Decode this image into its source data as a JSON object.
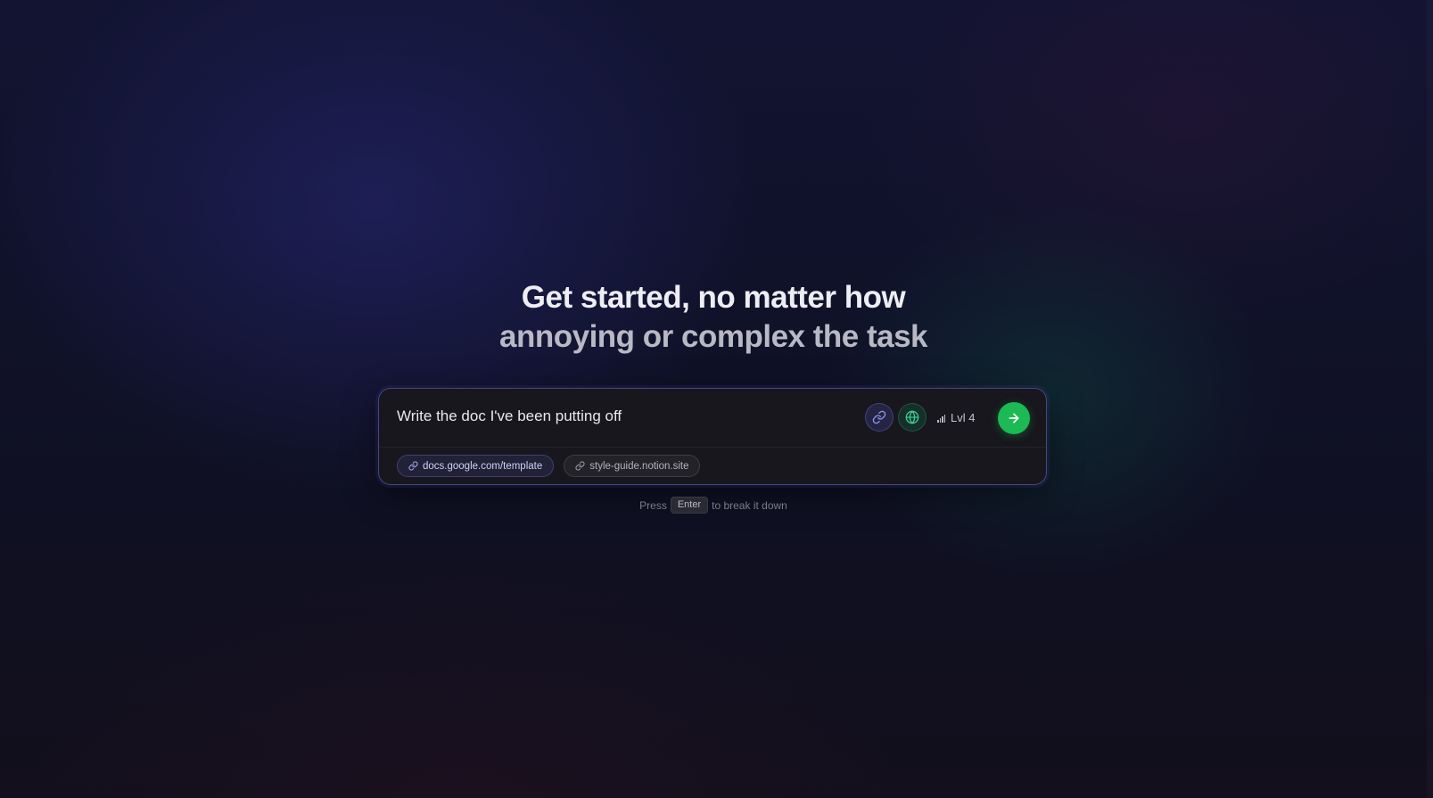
{
  "hero": {
    "line1": "Get started, no matter how",
    "line2": "annoying or complex the task"
  },
  "composer": {
    "task_value": "Write the doc I've been putting off",
    "link_button_icon": "link-icon",
    "web_button_icon": "globe-icon",
    "level_icon": "signal-bars-icon",
    "level_label": "Lvl 4",
    "submit_icon": "arrow-right-icon",
    "chips": [
      {
        "label": "docs.google.com/template",
        "icon": "link-icon"
      },
      {
        "label": "style-guide.notion.site",
        "icon": "link-icon"
      }
    ]
  },
  "hint": {
    "before": "Press",
    "key": "Enter",
    "after": "to break it down"
  },
  "colors": {
    "background": "#10122a",
    "accent_indigo": "#7b7ef0",
    "accent_green": "#1db954",
    "card": "#17171d"
  }
}
